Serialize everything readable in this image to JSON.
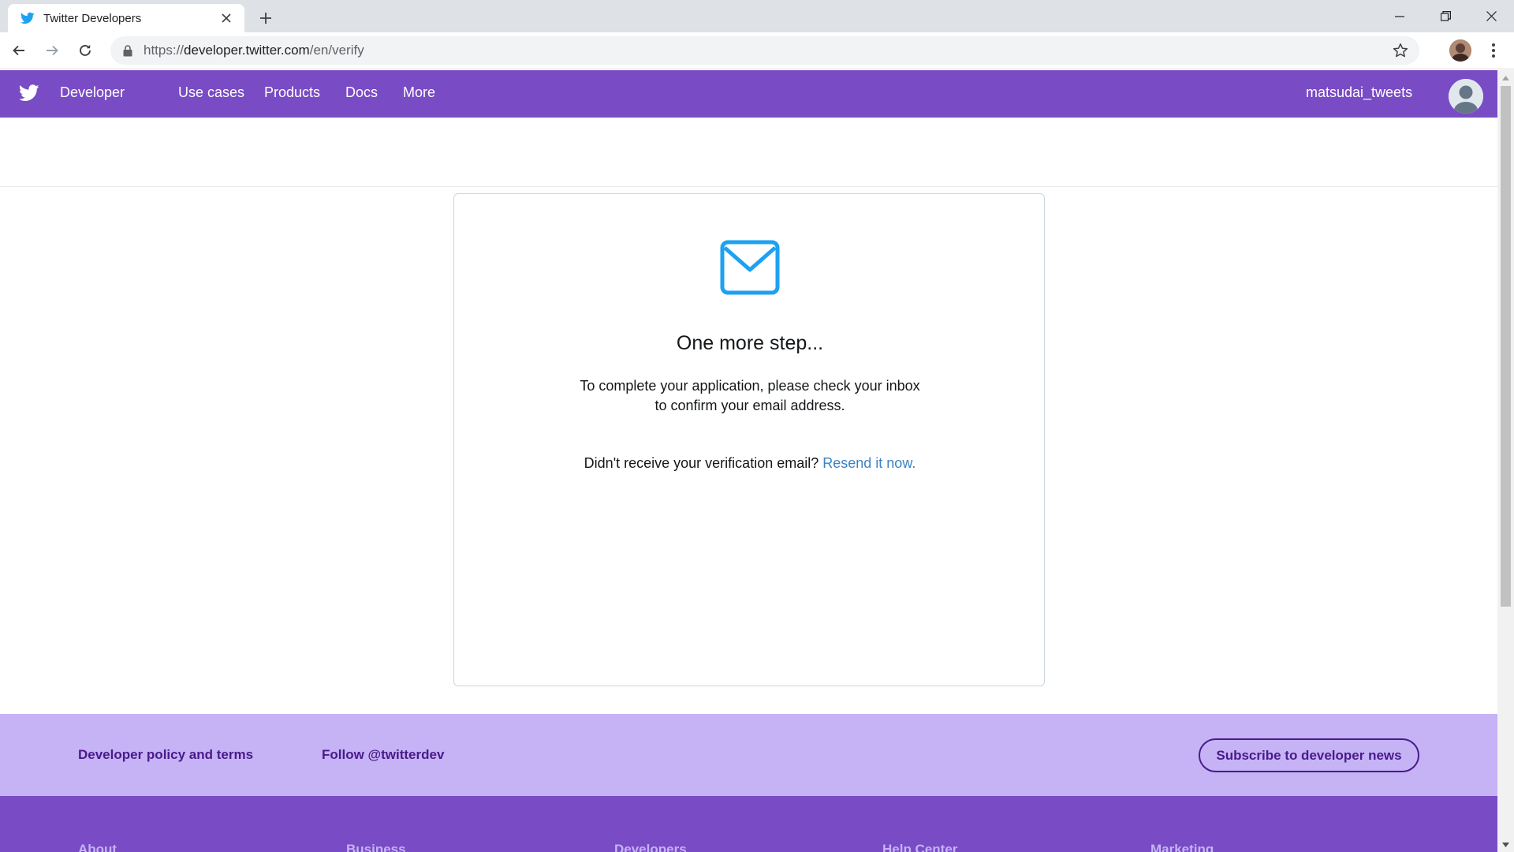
{
  "browser": {
    "tab_title": "Twitter Developers",
    "url_scheme": "https://",
    "url_host": "developer.twitter.com",
    "url_path": "/en/verify"
  },
  "nav": {
    "brand": "Developer",
    "links": [
      "Use cases",
      "Products",
      "Docs",
      "More"
    ],
    "username": "matsudai_tweets"
  },
  "card": {
    "title": "One more step...",
    "body": "To complete your application, please check your inbox to confirm your email address.",
    "resend_prompt": "Didn't receive your verification email? ",
    "resend_link": "Resend it now."
  },
  "footer": {
    "policy_link": "Developer policy and terms",
    "follow_link": "Follow @twitterdev",
    "subscribe_button": "Subscribe to developer news",
    "columns": [
      "About",
      "Business",
      "Developers",
      "Help Center",
      "Marketing"
    ]
  },
  "colors": {
    "nav_purple": "#794bc4",
    "footer_light": "#c5b3f5",
    "icon_blue": "#1da1f2",
    "link_blue": "#3b82c4"
  }
}
